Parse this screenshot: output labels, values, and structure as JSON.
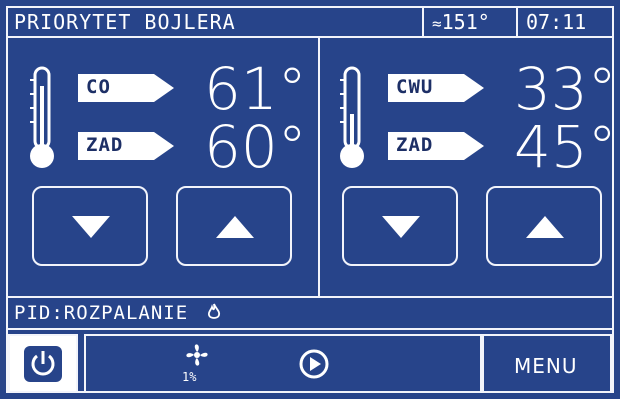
{
  "header": {
    "title": "PRIORYTET  BOJLERA",
    "outdoor_temp": "151°",
    "time": "07:11",
    "icons": [
      "link-icon"
    ]
  },
  "left_panel": {
    "tag1": "CO",
    "value1": "61°",
    "tag2": "ZAD",
    "value2": "60°"
  },
  "right_panel": {
    "tag1": "CWU",
    "value1": "33°",
    "tag2": "ZAD",
    "value2": "45°"
  },
  "status_line": "PID:ROZPALANIE",
  "bottom_bar": {
    "fan_percent": "1%",
    "menu_label": "MENU",
    "icons": [
      "power-icon",
      "fan-icon",
      "play-icon",
      "flame-icon"
    ]
  },
  "colors": {
    "background": "#27448a",
    "line": "#f2f4fb",
    "tag_text": "#1d2f66"
  }
}
